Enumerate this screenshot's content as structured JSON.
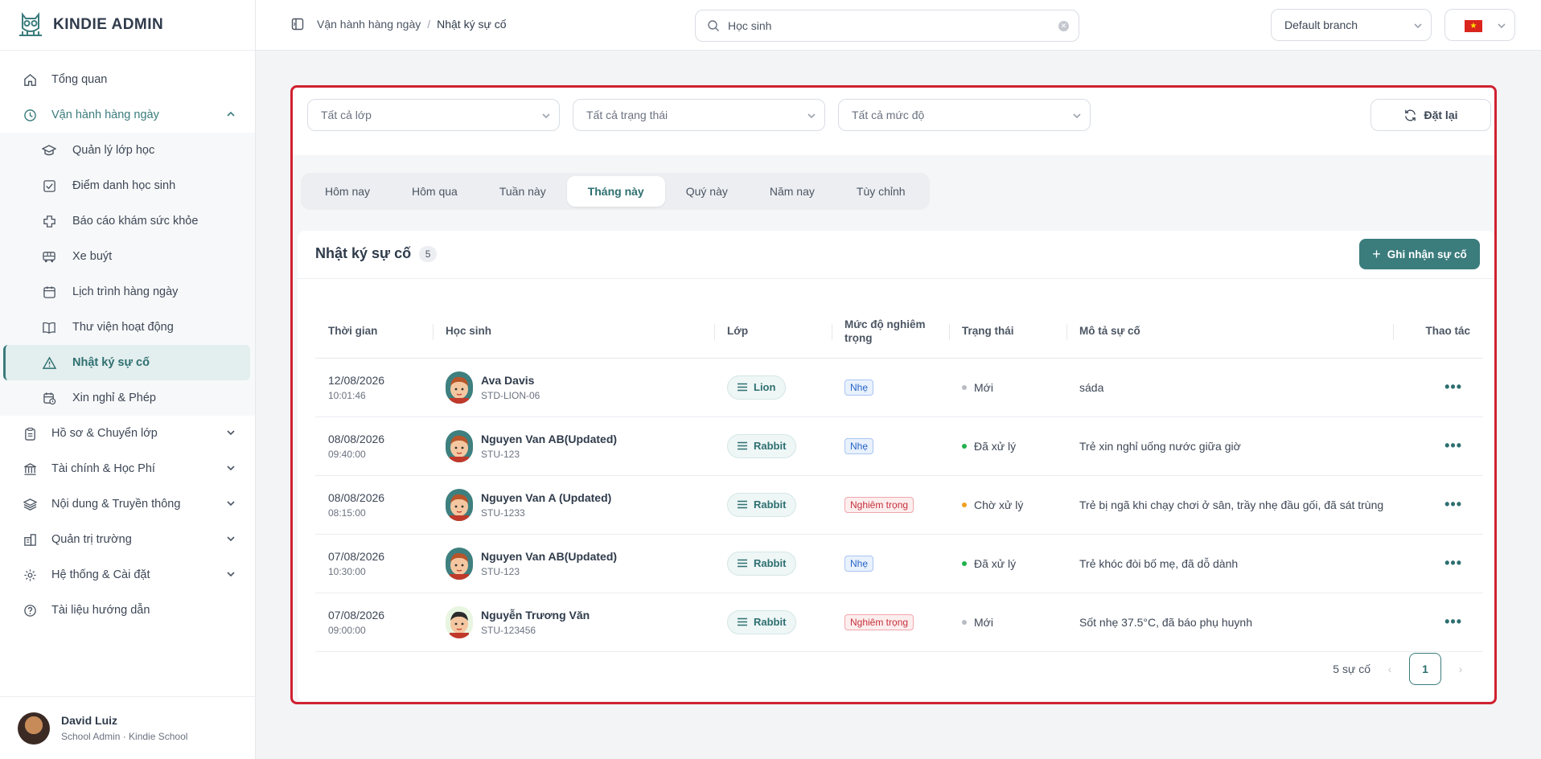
{
  "app": {
    "title": "KINDIE ADMIN"
  },
  "sidebar": {
    "items": [
      {
        "label": "Tổng quan",
        "icon": "home-icon"
      },
      {
        "label": "Vận hành hàng ngày",
        "icon": "clock-icon",
        "expanded": true
      },
      {
        "label": "Hồ sơ & Chuyển lớp",
        "icon": "clipboard-icon"
      },
      {
        "label": "Tài chính & Học Phí",
        "icon": "bank-icon"
      },
      {
        "label": "Nội dung & Truyền thông",
        "icon": "layers-icon"
      },
      {
        "label": "Quản trị trường",
        "icon": "building-icon"
      },
      {
        "label": "Hệ thống & Cài đặt",
        "icon": "gear-icon"
      },
      {
        "label": "Tài liệu hướng dẫn",
        "icon": "help-icon"
      }
    ],
    "sub_items": [
      {
        "label": "Quản lý lớp học",
        "icon": "graduation-cap-icon"
      },
      {
        "label": "Điểm danh học sinh",
        "icon": "checkbox-icon"
      },
      {
        "label": "Báo cáo khám sức khỏe",
        "icon": "medical-cross-icon"
      },
      {
        "label": "Xe buýt",
        "icon": "bus-icon"
      },
      {
        "label": "Lịch trình hàng ngày",
        "icon": "calendar-icon"
      },
      {
        "label": "Thư viện hoạt động",
        "icon": "book-icon"
      },
      {
        "label": "Nhật ký sự cố",
        "icon": "warning-icon",
        "active": true
      },
      {
        "label": "Xin nghỉ & Phép",
        "icon": "calendar-clock-icon"
      }
    ]
  },
  "user": {
    "name": "David Luiz",
    "role": "School Admin · Kindie School"
  },
  "topbar": {
    "breadcrumb": [
      "Vận hành hàng ngày",
      "Nhật ký sự cố"
    ],
    "breadcrumb_sep": "/",
    "search_value": "Học sinh",
    "branch": "Default branch",
    "language_flag": "vietnam-flag-icon"
  },
  "filters": {
    "class": "Tất cả lớp",
    "status": "Tất cả trạng thái",
    "severity": "Tất cả mức độ",
    "reset_label": "Đặt lại"
  },
  "tabs": [
    {
      "label": "Hôm nay"
    },
    {
      "label": "Hôm qua"
    },
    {
      "label": "Tuần này"
    },
    {
      "label": "Tháng này",
      "active": true
    },
    {
      "label": "Quý này"
    },
    {
      "label": "Năm nay"
    },
    {
      "label": "Tùy chỉnh"
    }
  ],
  "incidents": {
    "title": "Nhật ký sự cố",
    "count": "5",
    "add_label": "Ghi nhận sự cố",
    "columns": {
      "time": "Thời gian",
      "student": "Học sinh",
      "class": "Lớp",
      "severity": "Mức độ nghiêm trọng",
      "status": "Trạng thái",
      "description": "Mô tả sự cố",
      "actions": "Thao tác"
    },
    "rows": [
      {
        "date": "12/08/2026",
        "time": "10:01:46",
        "name": "Ava Davis",
        "code": "STD-LION-06",
        "class": "Lion",
        "severity": "Nhẹ",
        "severity_level": "light",
        "status": "Mới",
        "status_color": "#b8bcc2",
        "desc": "sáda"
      },
      {
        "date": "08/08/2026",
        "time": "09:40:00",
        "name": "Nguyen Van AB(Updated)",
        "code": "STU-123",
        "class": "Rabbit",
        "severity": "Nhẹ",
        "severity_level": "light",
        "status": "Đã xử lý",
        "status_color": "#22b14c",
        "desc": "Trẻ xin nghỉ uống nước giữa giờ"
      },
      {
        "date": "08/08/2026",
        "time": "08:15:00",
        "name": "Nguyen Van A (Updated)",
        "code": "STU-1233",
        "class": "Rabbit",
        "severity": "Nghiêm trọng",
        "severity_level": "severe",
        "status": "Chờ xử lý",
        "status_color": "#f0a020",
        "desc": "Trẻ bị ngã khi chạy chơi ở sân, trầy nhẹ đầu gối, đã sát trùng"
      },
      {
        "date": "07/08/2026",
        "time": "10:30:00",
        "name": "Nguyen Van AB(Updated)",
        "code": "STU-123",
        "class": "Rabbit",
        "severity": "Nhẹ",
        "severity_level": "light",
        "status": "Đã xử lý",
        "status_color": "#22b14c",
        "desc": "Trẻ khóc đòi bố mẹ, đã dỗ dành"
      },
      {
        "date": "07/08/2026",
        "time": "09:00:00",
        "name": "Nguyễn Trương Văn",
        "code": "STU-123456",
        "class": "Rabbit",
        "severity": "Nghiêm trọng",
        "severity_level": "severe",
        "status": "Mới",
        "status_color": "#b8bcc2",
        "desc": "Sốt nhẹ 37.5°C, đã báo phụ huynh"
      }
    ],
    "total_label": "5 sự cố",
    "page": "1"
  },
  "colors": {
    "accent": "#3b7c7d",
    "highlight_border": "#d02130"
  }
}
